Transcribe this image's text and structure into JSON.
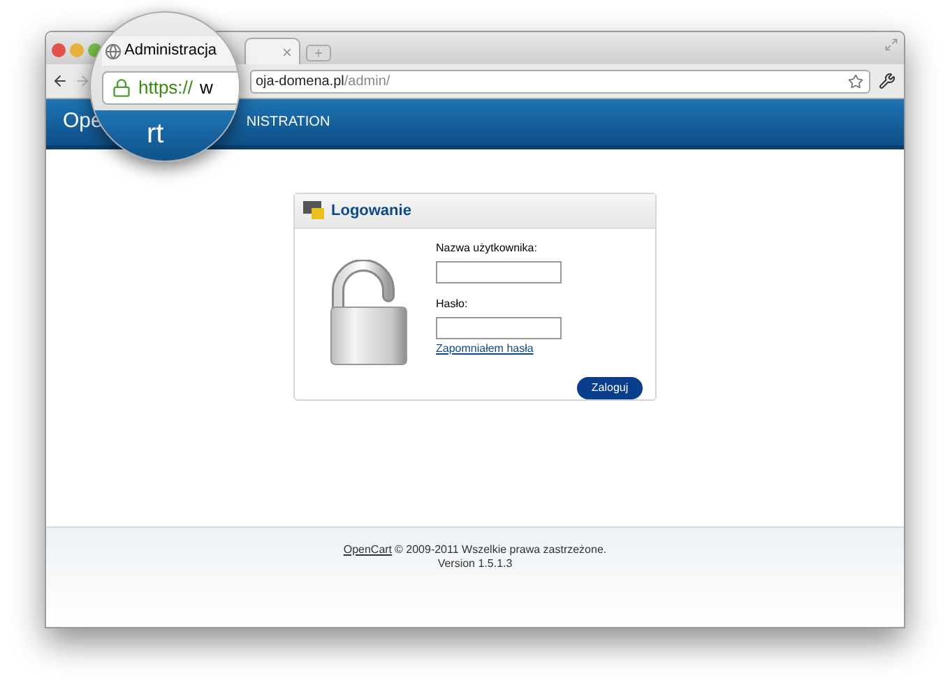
{
  "browser": {
    "tab": {
      "title": "Administracja"
    },
    "address": {
      "scheme": "https://",
      "host_zoomed": "w",
      "host": "oja-domena.pl",
      "path": "/admin/"
    }
  },
  "header": {
    "logo": "Ope",
    "logo_zoomed": "rt",
    "nav": "NISTRATION"
  },
  "login": {
    "title": "Logowanie",
    "username_label": "Nazwa użytkownika:",
    "password_label": "Hasło:",
    "forgot_link": "Zapomniałem hasła",
    "submit": "Zaloguj"
  },
  "footer": {
    "link": "OpenCart",
    "text": "© 2009-2011 Wszelkie prawa zastrzeżone.",
    "version": "Version 1.5.1.3"
  }
}
